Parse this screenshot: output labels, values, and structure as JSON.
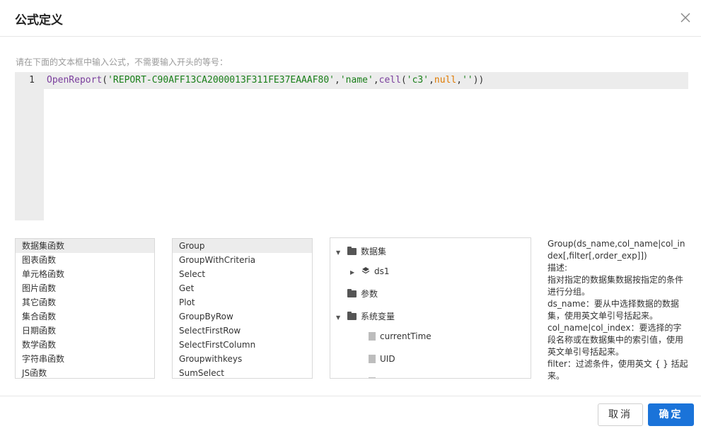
{
  "dialog": {
    "title": "公式定义",
    "close_icon": "close-icon"
  },
  "hint": "请在下面的文本框中输入公式，不需要输入开头的等号：",
  "editor": {
    "line_number": "1",
    "tokens": {
      "t1": "OpenReport",
      "t2": "(",
      "t3": "'REPORT-C90AFF13CA2000013F311FE37EAAAF80'",
      "t4": ",",
      "t5": "'name'",
      "t6": ",",
      "t7": "cell",
      "t8": "(",
      "t9": "'c3'",
      "t10": ",",
      "t11": "null",
      "t12": ",",
      "t13": "''",
      "t14": "))"
    },
    "colors": {
      "function": "#7a3e9d",
      "string": "#1a7f1a",
      "keyword": "#e07a00"
    }
  },
  "categories": [
    "数据集函数",
    "图表函数",
    "单元格函数",
    "图片函数",
    "其它函数",
    "集合函数",
    "日期函数",
    "数学函数",
    "字符串函数",
    "JS函数"
  ],
  "functions": [
    "Group",
    "GroupWithCriteria",
    "Select",
    "Get",
    "Plot",
    "GroupByRow",
    "SelectFirstRow",
    "SelectFirstColumn",
    "Groupwithkeys",
    "SumSelect"
  ],
  "tree": {
    "datasets": "数据集",
    "ds1": "ds1",
    "params": "参数",
    "sysvars": "系统变量",
    "current_time": "currentTime",
    "uid": "UID"
  },
  "description": {
    "signature": "Group(ds_name,col_name|col_index[,filter[,order_exp]])",
    "desc_label": "描述:",
    "desc_text": "指对指定的数据集数据按指定的条件进行分组。",
    "ds_name": "ds_name：要从中选择数据的数据集，使用英文单引号括起来。",
    "col_name": "col_name|col_index：要选择的字段名称或在数据集中的索引值，使用英文单引号括起来。",
    "filter": "filter：过滤条件，使用英文 { } 括起来。"
  },
  "buttons": {
    "cancel": "取消",
    "ok": "确定"
  },
  "accent_color": "#1a73d9"
}
